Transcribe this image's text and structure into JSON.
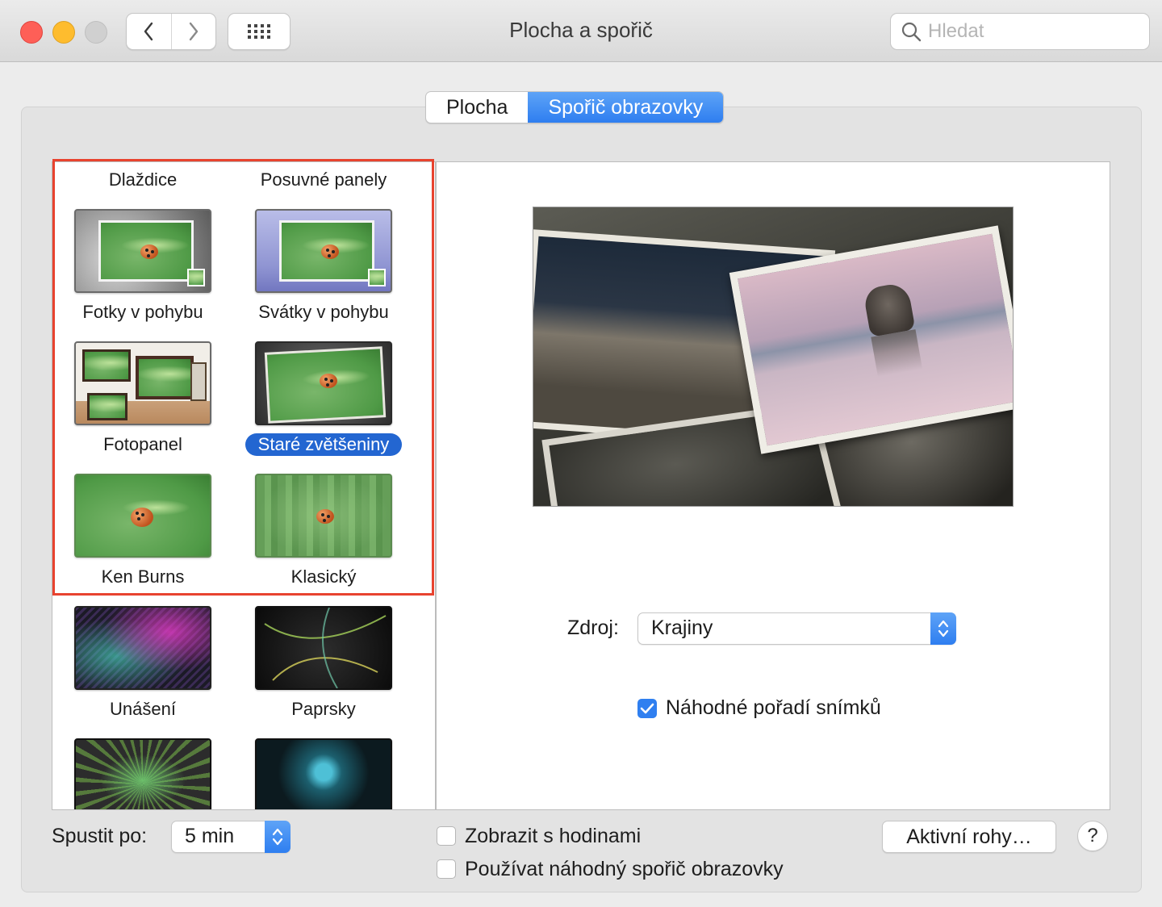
{
  "window": {
    "title": "Plocha a spořič",
    "search_placeholder": "Hledat"
  },
  "tabs": [
    {
      "label": "Plocha",
      "active": false
    },
    {
      "label": "Spořič obrazovky",
      "active": true
    }
  ],
  "savers": [
    {
      "label": "Dlaždice"
    },
    {
      "label": "Posuvné panely"
    },
    {
      "label": "Fotky v pohybu"
    },
    {
      "label": "Svátky v pohybu"
    },
    {
      "label": "Fotopanel"
    },
    {
      "label": "Staré zvětšeniny",
      "selected": true
    },
    {
      "label": "Ken Burns"
    },
    {
      "label": "Klasický"
    },
    {
      "label": "Unášení"
    },
    {
      "label": "Paprsky"
    }
  ],
  "source": {
    "label": "Zdroj:",
    "value": "Krajiny"
  },
  "shuffle": {
    "label": "Náhodné pořadí snímků",
    "checked": true
  },
  "start_after": {
    "label": "Spustit po:",
    "value": "5 min"
  },
  "show_clock": {
    "label": "Zobrazit s hodinami",
    "checked": false
  },
  "random_saver": {
    "label": "Používat náhodný spořič obrazovky",
    "checked": false
  },
  "hot_corners_button": "Aktivní rohy…",
  "help_button": "?",
  "colors": {
    "accent": "#2f7ff0",
    "selection": "#2366d1",
    "highlight_frame": "#e8432f"
  }
}
